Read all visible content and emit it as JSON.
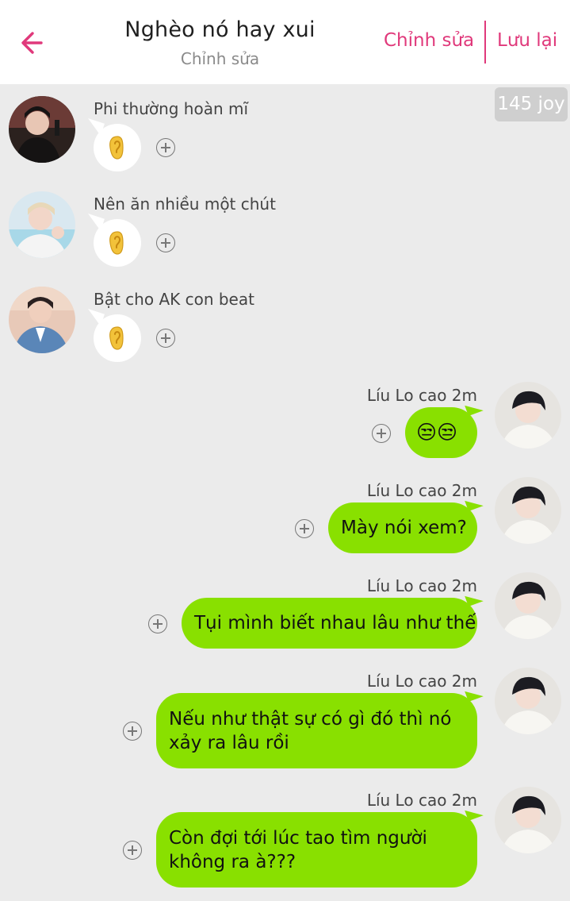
{
  "header": {
    "title": "Nghèo nó hay xui",
    "subtitle": "Chỉnh sửa",
    "edit_label": "Chỉnh sửa",
    "save_label": "Lưu lại",
    "back_icon": "arrow-left-icon",
    "accent_color": "#e0397b"
  },
  "badge": {
    "label": "145 joy"
  },
  "incoming": [
    {
      "name": "Phi thường hoàn mĩ",
      "emoji": "👂"
    },
    {
      "name": "Nên ăn nhiều một chút",
      "emoji": "👂"
    },
    {
      "name": "Bật cho AK con beat",
      "emoji": "👂"
    }
  ],
  "outgoing": [
    {
      "name": "Líu Lo cao 2m",
      "text": "😒😒"
    },
    {
      "name": "Líu Lo cao 2m",
      "text": "Mày nói xem?"
    },
    {
      "name": "Líu Lo cao 2m",
      "text": "Tụi mình biết nhau lâu như thế"
    },
    {
      "name": "Líu Lo cao 2m",
      "text_line1": "Nếu như thật sự có gì đó thì nó",
      "text_line2": "xảy ra lâu rồi"
    },
    {
      "name": "Líu Lo cao 2m",
      "text_line1": "Còn đợi tới lúc tao tìm người",
      "text_line2": "không ra à???"
    }
  ],
  "colors": {
    "bubble_green": "#89e000",
    "background": "#ebebeb"
  }
}
